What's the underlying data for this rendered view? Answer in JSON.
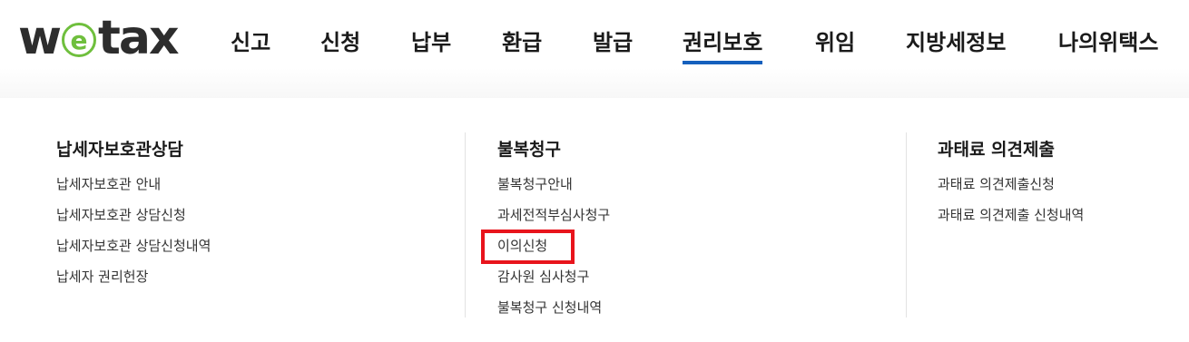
{
  "logo": {
    "prefix": "w",
    "e_letter": "e",
    "suffix": "tax"
  },
  "gnb": {
    "items": [
      {
        "label": "신고"
      },
      {
        "label": "신청"
      },
      {
        "label": "납부"
      },
      {
        "label": "환급"
      },
      {
        "label": "발급"
      },
      {
        "label": "권리보호",
        "active": true
      },
      {
        "label": "위임"
      },
      {
        "label": "지방세정보"
      },
      {
        "label": "나의위택스"
      }
    ],
    "active_color": "#1560bd"
  },
  "submenu": {
    "columns": [
      {
        "title": "납세자보호관상담",
        "links": [
          "납세자보호관 안내",
          "납세자보호관 상담신청",
          "납세자보호관 상담신청내역",
          "납세자 권리헌장"
        ]
      },
      {
        "title": "불복청구",
        "links": [
          "불복청구안내",
          "과세전적부심사청구",
          "이의신청",
          "감사원 심사청구",
          "불복청구 신청내역"
        ]
      },
      {
        "title": "과태료 의견제출",
        "links": [
          "과태료 의견제출신청",
          "과태료 의견제출 신청내역"
        ]
      }
    ]
  },
  "colors": {
    "logo_green": "#6fbf3d",
    "highlight_red": "#e8141c"
  }
}
